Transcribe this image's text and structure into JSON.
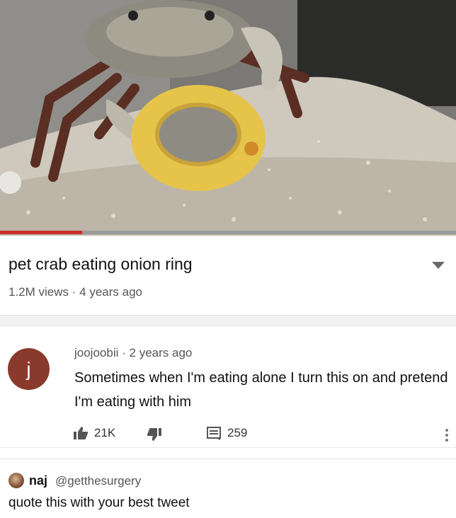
{
  "video": {
    "progress_fraction": 0.18,
    "title": "pet crab eating onion ring",
    "views": "1.2M views",
    "separator": "·",
    "age": "4 years ago",
    "expand_icon": "chevron-down-icon"
  },
  "comment": {
    "avatar_letter": "j",
    "avatar_color": "#8a3a2c",
    "author": "joojoobii",
    "separator": "·",
    "age": "2 years ago",
    "text": "Sometimes when I'm eating alone I turn this on and pretend I'm eating with him",
    "likes": "21K",
    "replies": "259",
    "icons": [
      "thumbs-up-icon",
      "thumbs-down-icon",
      "reply-icon",
      "more-vertical-icon"
    ]
  },
  "tweet": {
    "name": "naj",
    "handle": "@getthesurgery",
    "text": "quote this with your best tweet"
  },
  "colors": {
    "progress": "#cc2c2c",
    "muted_text": "#555555"
  }
}
